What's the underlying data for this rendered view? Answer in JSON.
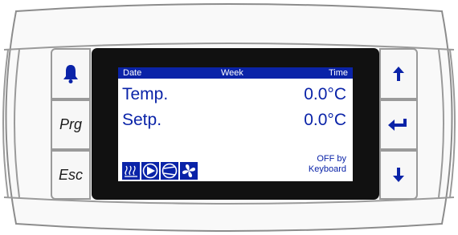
{
  "panel": {
    "left_buttons": [
      {
        "label": "",
        "icon": "bell-icon"
      },
      {
        "label": "Prg"
      },
      {
        "label": "Esc"
      }
    ],
    "right_buttons": [
      {
        "icon": "arrow-up-icon"
      },
      {
        "icon": "enter-icon"
      },
      {
        "icon": "arrow-down-icon"
      }
    ]
  },
  "lcd": {
    "header": {
      "date": "Date",
      "week": "Week",
      "time": "Time"
    },
    "rows": [
      {
        "label": "Temp.",
        "value": "0.0°C"
      },
      {
        "label": "Setp.",
        "value": "0.0°C"
      }
    ],
    "status_line1": "OFF by",
    "status_line2": "Keyboard",
    "status_icons": [
      "heater-icon",
      "pump-icon",
      "compressor-icon",
      "fan-icon"
    ]
  },
  "colors": {
    "lcd_blue": "#0a23a8",
    "frame_black": "#111111",
    "button_face": "#f7f7f7",
    "button_border": "#9a9a9a"
  }
}
